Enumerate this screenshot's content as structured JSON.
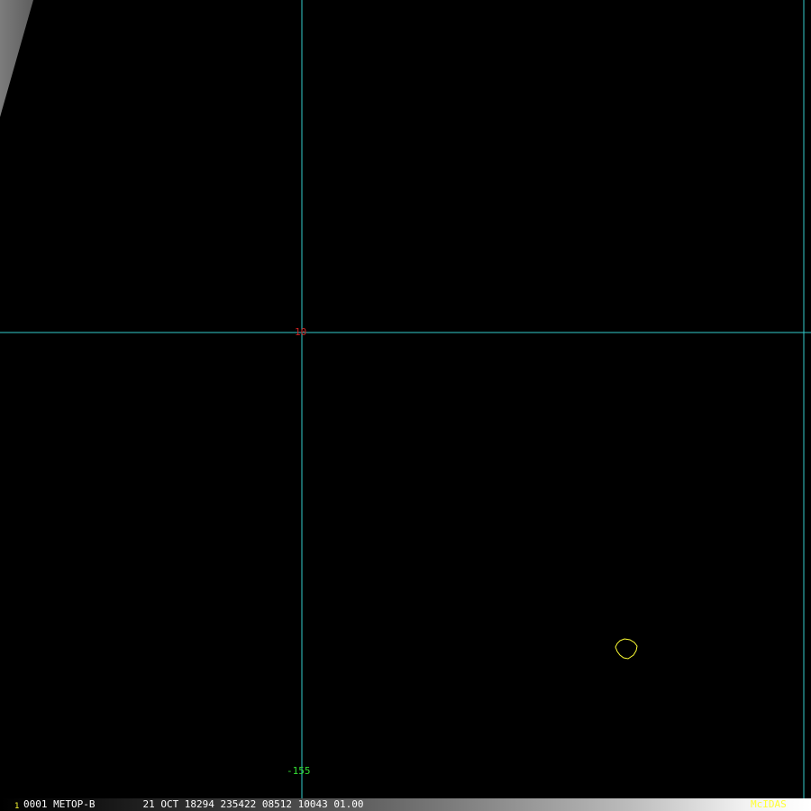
{
  "map": {
    "background_color": "#000000",
    "grid_color": "#33cccc",
    "lat_label": "10",
    "lat_label_color": "#cc2222",
    "lon_label": "-155",
    "lon_label_color": "#33dd33",
    "coast_color": "#ffff33"
  },
  "status_bar": {
    "frame_number": "1",
    "frame_number_color": "#ffff33",
    "info_text": "0001 METOP-B        21 OCT 18294 235422 08512 10043 01.00",
    "info_color": "#ffffff",
    "logo_text": "McIDAS",
    "logo_color": "#ffff33"
  }
}
